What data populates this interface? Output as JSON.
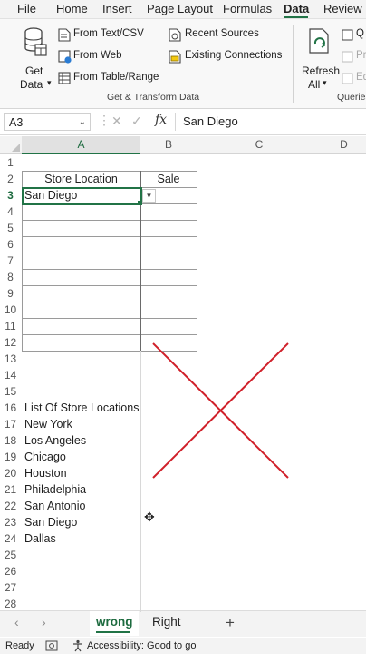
{
  "ribbon_tabs": [
    {
      "label": "File",
      "active": false
    },
    {
      "label": "Home",
      "active": false
    },
    {
      "label": "Insert",
      "active": false
    },
    {
      "label": "Page Layout",
      "active": false
    },
    {
      "label": "Formulas",
      "active": false
    },
    {
      "label": "Data",
      "active": true
    },
    {
      "label": "Review",
      "active": false
    }
  ],
  "ribbon": {
    "get_data_line1": "Get",
    "get_data_line2": "Data",
    "from_text_csv": "From Text/CSV",
    "from_web": "From Web",
    "from_table_range": "From Table/Range",
    "recent_sources": "Recent Sources",
    "existing_connections": "Existing Connections",
    "refresh_line1": "Refresh",
    "refresh_line2": "All",
    "group_get_transform": "Get & Transform Data",
    "group_queries": "Queries",
    "clipped_q": "Q",
    "clipped_pr": "Pr",
    "clipped_ed": "Ed"
  },
  "formula_bar": {
    "name_box": "A3",
    "fx_label": "fx",
    "content": "San Diego"
  },
  "columns": [
    "A",
    "B",
    "C",
    "D"
  ],
  "rows": [
    "1",
    "2",
    "3",
    "4",
    "5",
    "6",
    "7",
    "8",
    "9",
    "10",
    "11",
    "12",
    "13",
    "14",
    "15",
    "16",
    "17",
    "18",
    "19",
    "20",
    "21",
    "22",
    "23",
    "24",
    "25",
    "26",
    "27",
    "28"
  ],
  "cells": {
    "A2": "Store Location",
    "B2": "Sale",
    "A3": "San Diego",
    "A16": "List Of Store Locations",
    "A17": "New York",
    "A18": "Los Angeles",
    "A19": "Chicago",
    "A20": "Houston",
    "A21": "Philadelphia",
    "A22": "San Antonio",
    "A23": "San Diego",
    "A24": "Dallas"
  },
  "sheets": [
    {
      "label": "wrong",
      "active": true
    },
    {
      "label": "Right",
      "active": false
    }
  ],
  "status": {
    "ready": "Ready",
    "accessibility": "Accessibility: Good to go"
  },
  "colors": {
    "accent": "#217346",
    "cross": "#d0202a"
  }
}
